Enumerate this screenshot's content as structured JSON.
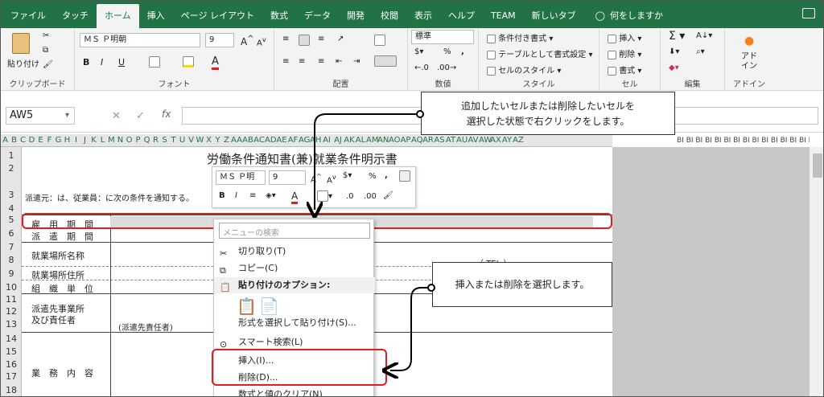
{
  "tabs": [
    "ファイル",
    "タッチ",
    "ホーム",
    "挿入",
    "ページ レイアウト",
    "数式",
    "データ",
    "開発",
    "校閲",
    "表示",
    "ヘルプ",
    "TEAM",
    "新しいタブ"
  ],
  "active_tab_index": 2,
  "tell_me": "何をしますか",
  "ribbon": {
    "clipboard": {
      "paste": "貼り付け",
      "label": "クリップボード"
    },
    "font": {
      "name": "ＭＳ Ｐ明朝",
      "size": "9",
      "label": "フォント",
      "bold": "B",
      "italic": "I",
      "underline": "U"
    },
    "alignment": {
      "label": "配置"
    },
    "number": {
      "format": "標準",
      "label": "数値",
      "percent": "%"
    },
    "styles": {
      "conditional": "条件付き書式",
      "table": "テーブルとして書式設定",
      "cell_style": "セルのスタイル",
      "label": "スタイル"
    },
    "cells": {
      "insert": "挿入",
      "delete": "削除",
      "format": "書式",
      "label": "セル"
    },
    "editing": {
      "label": "編集"
    },
    "addins": {
      "button": "アド\nイン",
      "label": "アドイン"
    }
  },
  "formula_bar": {
    "name_box": "AW5",
    "fx": "fx",
    "value": ""
  },
  "column_letters": [
    "A",
    "B",
    "C",
    "D",
    "E",
    "F",
    "G",
    "H",
    "I",
    "J",
    "K",
    "L",
    "M",
    "N",
    "O",
    "P",
    "Q",
    "R",
    "S",
    "T",
    "U",
    "V",
    "W",
    "X",
    "Y",
    "Z",
    "AA",
    "AB",
    "AC",
    "AD",
    "AE",
    "AF",
    "AG",
    "AH",
    "AI",
    "AJ",
    "AK",
    "AL",
    "AM",
    "AN",
    "AO",
    "AP",
    "AQ",
    "AR",
    "AS",
    "AT",
    "AU",
    "AV",
    "AW",
    "AX",
    "AY",
    "AZ"
  ],
  "column_letters_right": "BI BI BI BI BI BI BI BI BI BI BI BI BI BI BI",
  "row_numbers": [
    "1",
    "2",
    "3",
    "4",
    "5",
    "6",
    "7",
    "8",
    "9",
    "10",
    "11",
    "12",
    "13",
    "14",
    "15",
    "16",
    "17",
    "18"
  ],
  "sheet": {
    "title": "労働条件通知書(兼)就業条件明示書",
    "intro": "派遣元：は、従業員：に次の条件を通知する。",
    "labels": {
      "koyou": "雇　用　期　間",
      "haken": "派　遣　期　間",
      "shugyo_name": "就業場所名称",
      "shugyo_addr": "就業場所住所",
      "soshiki": "組　織　単　位",
      "hakensaki_1": "派遣先事業所",
      "hakensaki_2": "及び責任者",
      "gyomu": "業　務　内　容"
    },
    "hakensaki_note": "(派遣先責任者)",
    "tel": "（ TEL ）"
  },
  "mini_toolbar": {
    "font": "ＭＳ Ｐ明",
    "size": "9",
    "percent": "%",
    "comma": ","
  },
  "context_menu": {
    "search_placeholder": "メニューの検索",
    "items": [
      "切り取り(T)",
      "コピー(C)",
      "貼り付けのオプション:",
      "形式を選択して貼り付け(S)...",
      "スマート検索(L)",
      "挿入(I)...",
      "削除(D)...",
      "数式と値のクリア(N)"
    ]
  },
  "callouts": {
    "top": "追加したいセルまたは削除したいセルを\n選択した状態で右クリックをします。",
    "right": "挿入または削除を選択します。"
  },
  "colors": {
    "excel_green": "#217346",
    "highlight_red": "#e02020"
  }
}
